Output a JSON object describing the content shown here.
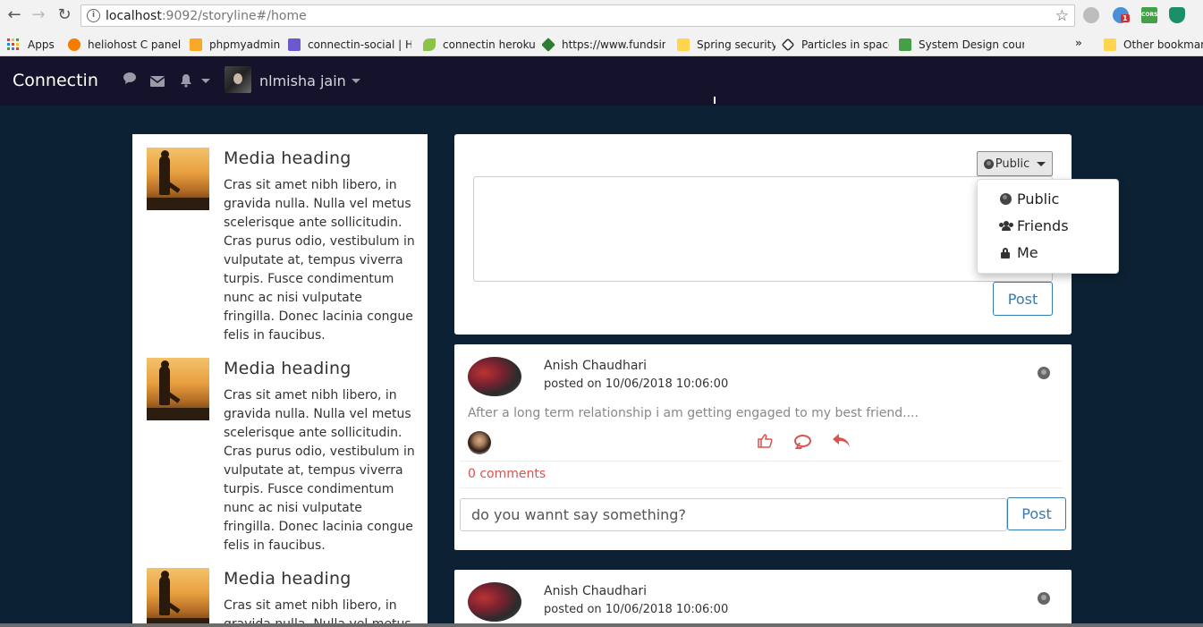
{
  "browser": {
    "url_host": "localhost",
    "url_rest": ":9092/storyline#/home",
    "bookmarks": [
      {
        "label": "Apps",
        "color": "#e53935"
      },
      {
        "label": "heliohost C panel",
        "color": "#f57c00"
      },
      {
        "label": "phpmyadmin",
        "color": "#f9a825"
      },
      {
        "label": "connectin-social | He",
        "color": "#6a5acd"
      },
      {
        "label": "connectin heroku",
        "color": "#8bc34a"
      },
      {
        "label": "https://www.fundsin",
        "color": "#2e7d32"
      },
      {
        "label": "Spring security",
        "color": "#ffd54f"
      },
      {
        "label": "Particles in space",
        "color": "#333333"
      },
      {
        "label": "System Design cours",
        "color": "#43a047"
      }
    ],
    "more_bookmarks": "»",
    "other_bookmarks": "Other bookmarks",
    "extension_badge": "1",
    "cors_label": "CORS"
  },
  "navbar": {
    "brand": "Connectin",
    "user_name": "nlmisha jain"
  },
  "left_panel": {
    "items": [
      {
        "heading": "Media heading",
        "text": "Cras sit amet nibh libero, in gravida nulla. Nulla vel metus scelerisque ante sollicitudin. Cras purus odio, vestibulum in vulputate at, tempus viverra turpis. Fusce condimentum nunc ac nisi vulputate fringilla. Donec lacinia congue felis in faucibus."
      },
      {
        "heading": "Media heading",
        "text": "Cras sit amet nibh libero, in gravida nulla. Nulla vel metus scelerisque ante sollicitudin. Cras purus odio, vestibulum in vulputate at, tempus viverra turpis. Fusce condimentum nunc ac nisi vulputate fringilla. Donec lacinia congue felis in faucibus."
      },
      {
        "heading": "Media heading",
        "text": "Cras sit amet nibh libero, in gravida nulla. Nulla vel metus"
      }
    ]
  },
  "composer": {
    "privacy_label": "Public",
    "post_label": "Post",
    "dropdown": [
      {
        "label": "Public",
        "icon": "globe-icon"
      },
      {
        "label": "Friends",
        "icon": "users-icon"
      },
      {
        "label": "Me",
        "icon": "lock-icon"
      }
    ]
  },
  "posts": [
    {
      "author": "Anish Chaudhari",
      "date": "posted on 10/06/2018 10:06:00",
      "content": "After a long term relationship i am getting engaged to my best friend....",
      "comments": "0 comments",
      "comment_placeholder": "do you wannt say something?",
      "post_label": "Post"
    },
    {
      "author": "Anish Chaudhari",
      "date": "posted on 10/06/2018 10:06:00"
    }
  ],
  "colors": {
    "background": "#0c2133",
    "navbar": "#15132b",
    "accent_blue": "#337ab7",
    "action_red": "#d9534f"
  }
}
